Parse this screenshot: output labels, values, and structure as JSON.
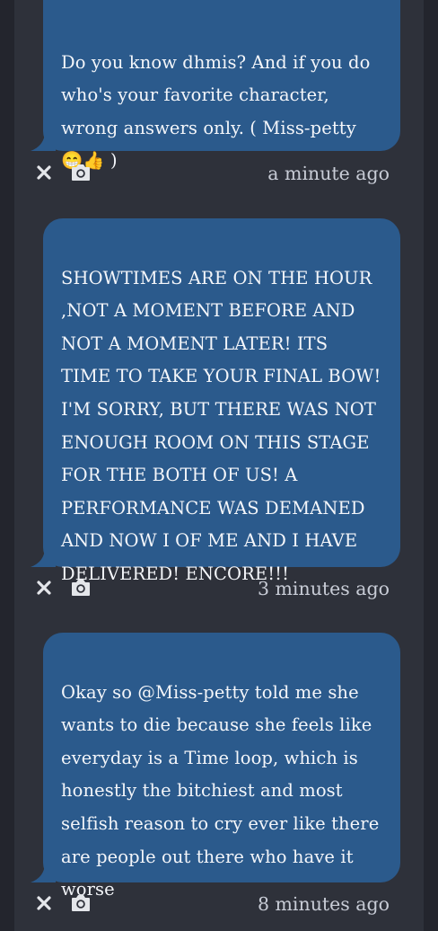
{
  "posts": [
    {
      "text": "Do you know dhmis? And if you do\nwho's your favorite character,\nwrong answers only. ( Miss-petty\n😁👍 )",
      "time": "a minute ago"
    },
    {
      "text": "SHOWTIMES ARE ON THE HOUR\n,NOT A MOMENT BEFORE AND\nNOT A MOMENT LATER! ITS\nTIME TO TAKE YOUR FINAL BOW!\nI'M SORRY, BUT THERE WAS NOT\nENOUGH ROOM ON THIS STAGE\nFOR THE BOTH OF US! A\nPERFORMANCE WAS DEMANED\nAND NOW I OF ME AND I HAVE\nDELIVERED! ENCORE!!!",
      "time": "3 minutes ago"
    },
    {
      "text": "Okay so @Miss-petty told me she\nwants to die because she feels like\neveryday is a Time loop, which is\nhonestly the bitchiest and most\nselfish reason to cry ever like there\nare people out there who have it\nworse",
      "time": "8 minutes ago"
    }
  ],
  "icons": {
    "delete": "close-icon",
    "photo": "camera-icon"
  },
  "colors": {
    "bubble": "#2b5a8c",
    "background": "#2e313a",
    "icon": "#e4e6ea"
  }
}
